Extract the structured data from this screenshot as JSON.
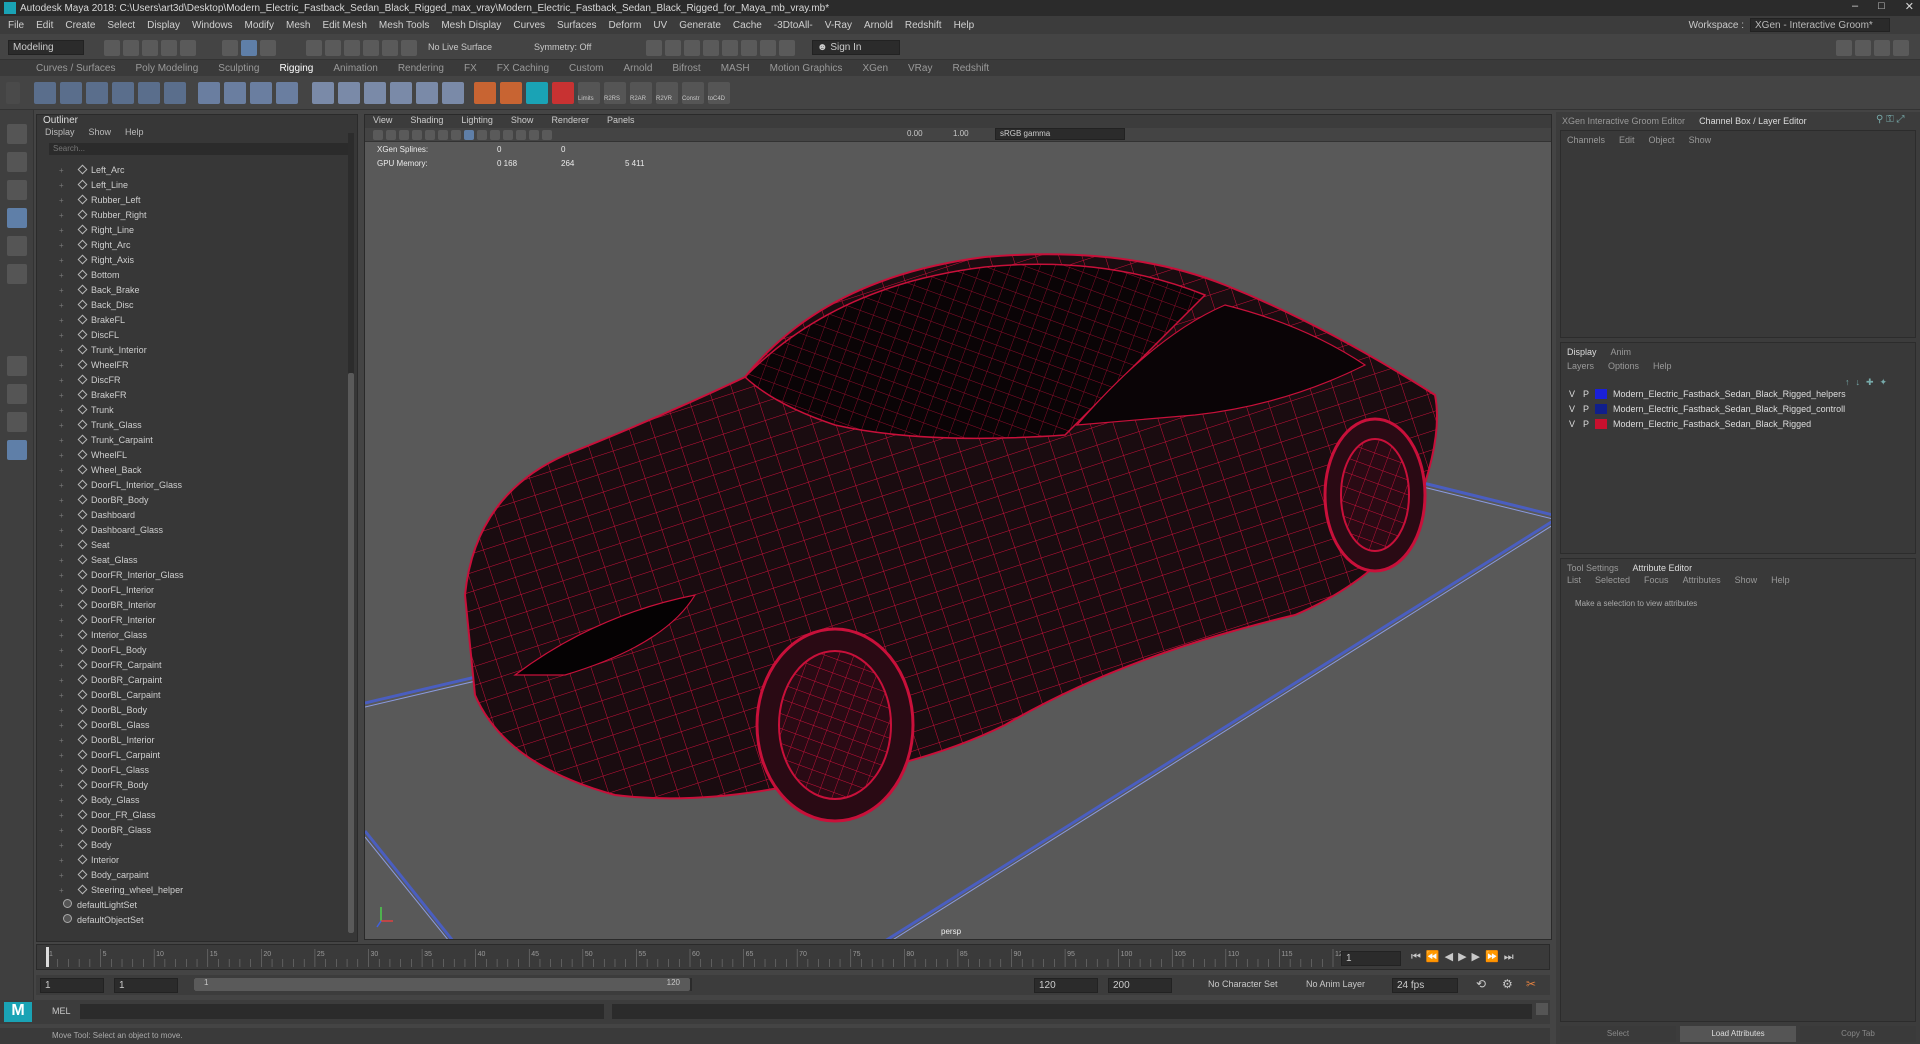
{
  "title": "Autodesk Maya 2018: C:\\Users\\art3d\\Desktop\\Modern_Electric_Fastback_Sedan_Black_Rigged_max_vray\\Modern_Electric_Fastback_Sedan_Black_Rigged_for_Maya_mb_vray.mb*",
  "window_controls": [
    "–",
    "□",
    "✕"
  ],
  "menus": [
    "File",
    "Edit",
    "Create",
    "Select",
    "Display",
    "Windows",
    "Modify",
    "Mesh",
    "Edit Mesh",
    "Mesh Tools",
    "Mesh Display",
    "Curves",
    "Surfaces",
    "Deform",
    "UV",
    "Generate",
    "Cache",
    "-3DtoAll-",
    "V-Ray",
    "Arnold",
    "Redshift",
    "Help"
  ],
  "workspace": {
    "label": "Workspace :",
    "value": "XGen - Interactive Groom*"
  },
  "status": {
    "mode": "Modeling",
    "live_surface": "No Live Surface",
    "symmetry": "Symmetry: Off",
    "sign_in": "Sign In"
  },
  "shelf_tabs": [
    "Curves / Surfaces",
    "Poly Modeling",
    "Sculpting",
    "Rigging",
    "Animation",
    "Rendering",
    "FX",
    "FX Caching",
    "Custom",
    "Arnold",
    "Bifrost",
    "MASH",
    "Motion Graphics",
    "XGen",
    "VRay",
    "Redshift"
  ],
  "shelf_active_tab": "Rigging",
  "shelf_labels": [
    "Limits",
    "R2RS",
    "R2AR",
    "R2VR",
    "Constr",
    "toC4D"
  ],
  "outliner": {
    "title": "Outliner",
    "menu": [
      "Display",
      "Show",
      "Help"
    ],
    "search_placeholder": "Search...",
    "items": [
      "Left_Arc",
      "Left_Line",
      "Rubber_Left",
      "Rubber_Right",
      "Right_Line",
      "Right_Arc",
      "Right_Axis",
      "Bottom",
      "Back_Brake",
      "Back_Disc",
      "BrakeFL",
      "DiscFL",
      "Trunk_Interior",
      "WheelFR",
      "DiscFR",
      "BrakeFR",
      "Trunk",
      "Trunk_Glass",
      "Trunk_Carpaint",
      "WheelFL",
      "Wheel_Back",
      "DoorFL_Interior_Glass",
      "DoorBR_Body",
      "Dashboard",
      "Dashboard_Glass",
      "Seat",
      "Seat_Glass",
      "DoorFR_Interior_Glass",
      "DoorFL_Interior",
      "DoorBR_Interior",
      "DoorFR_Interior",
      "Interior_Glass",
      "DoorFL_Body",
      "DoorFR_Carpaint",
      "DoorBR_Carpaint",
      "DoorBL_Carpaint",
      "DoorBL_Body",
      "DoorBL_Glass",
      "DoorBL_Interior",
      "DoorFL_Carpaint",
      "DoorFL_Glass",
      "DoorFR_Body",
      "Body_Glass",
      "Door_FR_Glass",
      "DoorBR_Glass",
      "Body",
      "Interior",
      "Body_carpaint",
      "Steering_wheel_helper"
    ],
    "sets": [
      "defaultLightSet",
      "defaultObjectSet"
    ]
  },
  "viewport": {
    "menu": [
      "View",
      "Shading",
      "Lighting",
      "Show",
      "Renderer",
      "Panels"
    ],
    "exposure": "0.00",
    "gamma": "1.00",
    "color_space": "sRGB gamma",
    "hud": [
      {
        "label": "XGen Splines:",
        "v1": "0",
        "v2": "0",
        "v3": ""
      },
      {
        "label": "GPU Memory:",
        "v1": "0 168",
        "v2": "264",
        "v3": "5 411"
      }
    ],
    "camera": "persp"
  },
  "timeline": {
    "ticks": [
      "1",
      "5",
      "10",
      "15",
      "20",
      "25",
      "30",
      "35",
      "40",
      "45",
      "50",
      "55",
      "60",
      "65",
      "70",
      "75",
      "80",
      "85",
      "90",
      "95",
      "100",
      "105",
      "110",
      "115",
      "120"
    ],
    "current_frame": "1"
  },
  "range": {
    "start": "1",
    "start2": "1",
    "slider_start": "1",
    "slider_end": "120",
    "end": "120",
    "end2": "200",
    "character_set": "No Character Set",
    "anim_layer": "No Anim Layer",
    "fps": "24 fps"
  },
  "mel": {
    "label": "MEL"
  },
  "help_line": "Move Tool: Select an object to move.",
  "right_panel": {
    "top_tabs": [
      "XGen Interactive Groom Editor",
      "Channel Box / Layer Editor"
    ],
    "channel_menu": [
      "Channels",
      "Edit",
      "Object",
      "Show"
    ],
    "layer_tabs": [
      "Display",
      "Anim"
    ],
    "layer_menu": [
      "Layers",
      "Options",
      "Help"
    ],
    "layers": [
      {
        "v": "V",
        "p": "P",
        "color": "#1a20d8",
        "name": "Modern_Electric_Fastback_Sedan_Black_Rigged_helpers"
      },
      {
        "v": "V",
        "p": "P",
        "color": "#101f8c",
        "name": "Modern_Electric_Fastback_Sedan_Black_Rigged_controll"
      },
      {
        "v": "V",
        "p": "P",
        "color": "#c8102e",
        "name": "Modern_Electric_Fastback_Sedan_Black_Rigged"
      }
    ],
    "attr_tabs": [
      "Tool Settings",
      "Attribute Editor"
    ],
    "attr_menu": [
      "List",
      "Selected",
      "Focus",
      "Attributes",
      "Show",
      "Help"
    ],
    "attr_msg": "Make a selection to view attributes",
    "buttons": [
      "Select",
      "Load Attributes",
      "Copy Tab"
    ]
  },
  "colors": {
    "wire": "#c8103a",
    "accent": "#1aa3b5"
  }
}
